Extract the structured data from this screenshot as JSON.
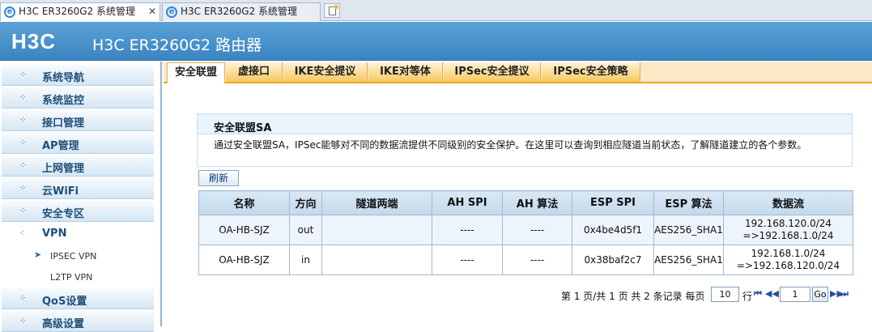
{
  "browser": {
    "tabs": [
      {
        "title": "H3C ER3260G2 系统管理",
        "close": "✕",
        "active": true
      },
      {
        "title": "H3C ER3260G2 系统管理",
        "active": false
      }
    ]
  },
  "header": {
    "logo": "H3C",
    "title": "H3C ER3260G2 路由器"
  },
  "sidebar": {
    "items": [
      {
        "label": "系统导航"
      },
      {
        "label": "系统监控"
      },
      {
        "label": "接口管理"
      },
      {
        "label": "AP管理"
      },
      {
        "label": "上网管理"
      },
      {
        "label": "云WiFi"
      },
      {
        "label": "安全专区"
      },
      {
        "label": "VPN"
      },
      {
        "label": "QoS设置"
      },
      {
        "label": "高级设置"
      }
    ],
    "vpn_sub": [
      {
        "label": "IPSEC VPN",
        "selected": true
      },
      {
        "label": "L2TP VPN",
        "selected": false
      }
    ]
  },
  "content_tabs": [
    {
      "label": "安全联盟",
      "active": true
    },
    {
      "label": "虚接口"
    },
    {
      "label": "IKE安全提议"
    },
    {
      "label": "IKE对等体"
    },
    {
      "label": "IPSec安全提议"
    },
    {
      "label": "IPSec安全策略"
    }
  ],
  "panel": {
    "title": "安全联盟SA",
    "description": "通过安全联盟SA，IPSec能够对不同的数据流提供不同级别的安全保护。在这里可以查询到相应隧道当前状态，了解隧道建立的各个参数。",
    "refresh_label": "刷新"
  },
  "table": {
    "headers": [
      "名称",
      "方向",
      "隧道两端",
      "AH SPI",
      "AH 算法",
      "ESP SPI",
      "ESP 算法",
      "数据流"
    ],
    "rows": [
      {
        "name": "OA-HB-SJZ",
        "direction": "out",
        "tunnel": "",
        "ah_spi": "----",
        "ah_alg": "----",
        "esp_spi": "0x4be4d5f1",
        "esp_alg": "AES256_SHA1",
        "flow_src": "192.168.120.0/24",
        "flow_dst": "=>192.168.1.0/24"
      },
      {
        "name": "OA-HB-SJZ",
        "direction": "in",
        "tunnel": "",
        "ah_spi": "----",
        "ah_alg": "----",
        "esp_spi": "0x38baf2c7",
        "esp_alg": "AES256_SHA1",
        "flow_src": "192.168.1.0/24",
        "flow_dst": "=>192.168.120.0/24"
      }
    ]
  },
  "pager": {
    "summary": "第 1 页/共 1 页 共 2 条记录 每页",
    "per_page": "10",
    "per_page_unit": "行",
    "current_page": "1",
    "go_label": "Go",
    "first": "⏮",
    "prev": "◀◀",
    "next": "▶▶",
    "last": "⏭"
  }
}
